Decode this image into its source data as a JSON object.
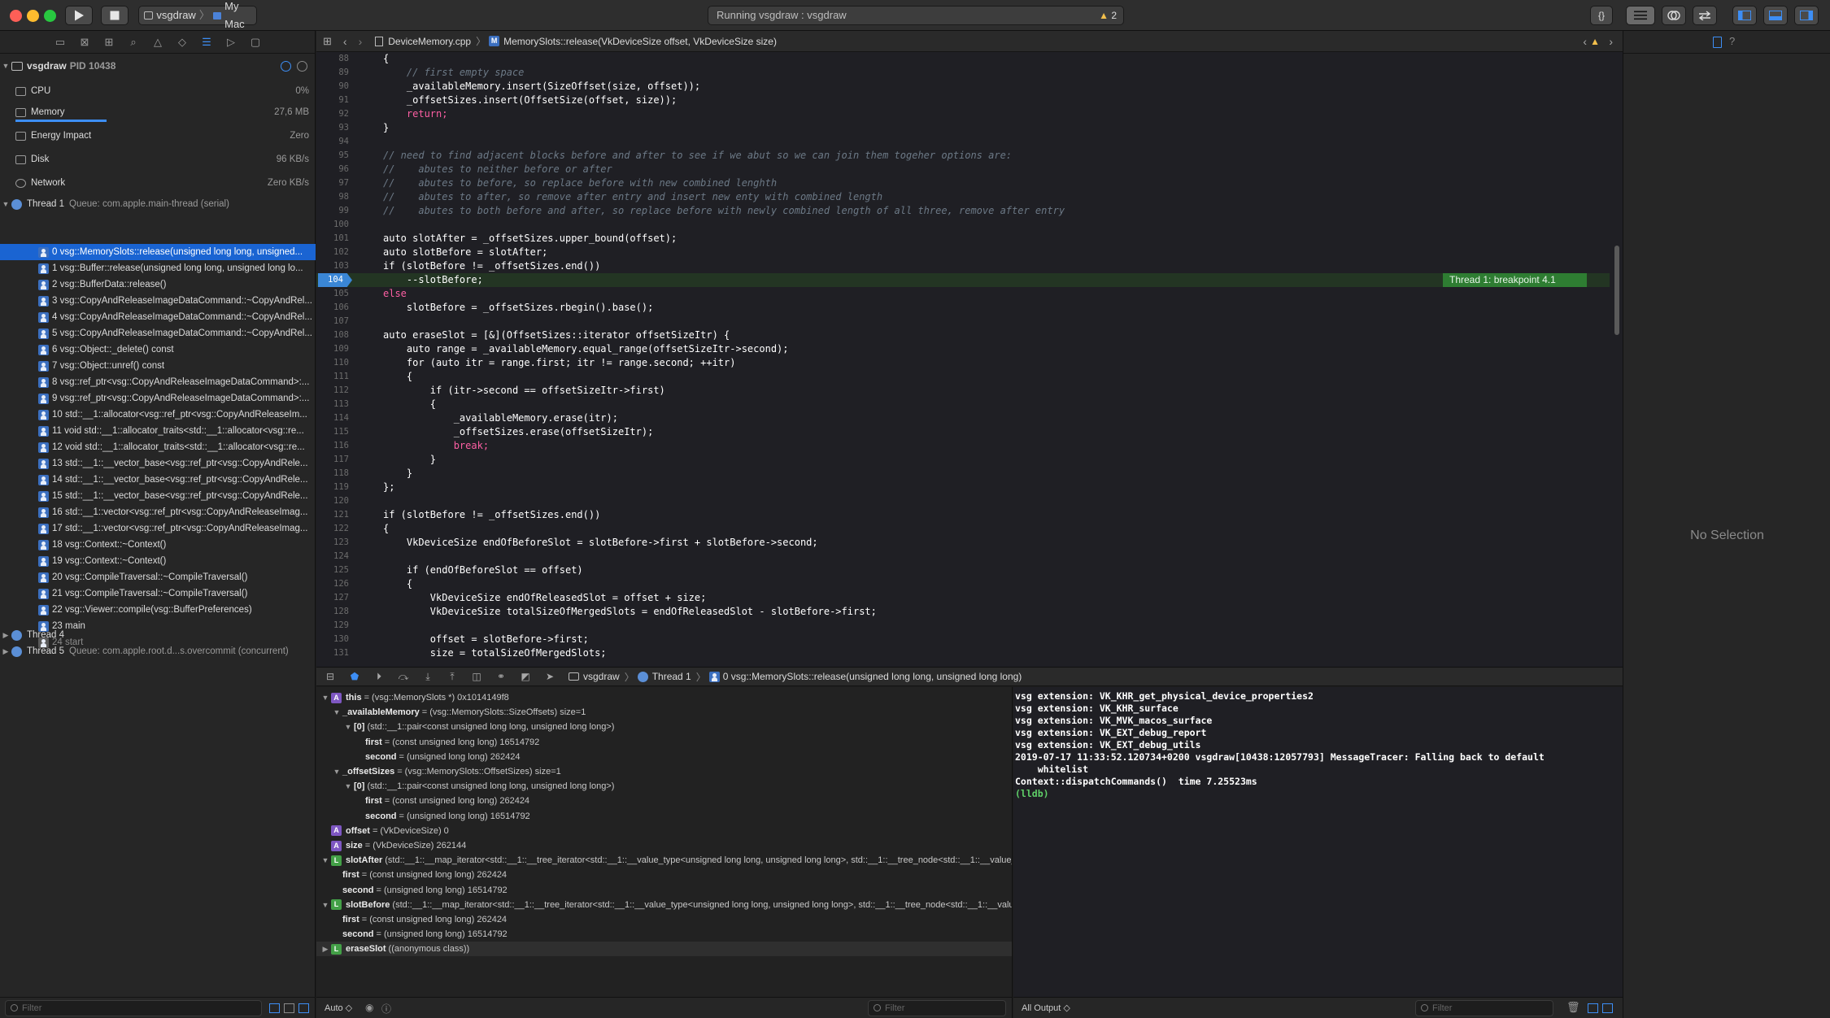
{
  "toolbar": {
    "scheme_target": "vsgdraw",
    "scheme_device": "My Mac",
    "activity_text": "Running vsgdraw : vsgdraw",
    "warning_count": "2",
    "code_review_label": "{}"
  },
  "navigator": {
    "process_name": "vsgdraw",
    "process_pid": "PID 10438",
    "gauges": [
      {
        "label": "CPU",
        "value": "0%"
      },
      {
        "label": "Memory",
        "value": "27,6 MB"
      },
      {
        "label": "Energy Impact",
        "value": "Zero"
      },
      {
        "label": "Disk",
        "value": "96 KB/s"
      },
      {
        "label": "Network",
        "value": "Zero KB/s"
      }
    ],
    "thread1_label": "Thread 1",
    "thread1_queue": "Queue: com.apple.main-thread (serial)",
    "frames": [
      "0 vsg::MemorySlots::release(unsigned long long, unsigned...",
      "1 vsg::Buffer::release(unsigned long long, unsigned long lo...",
      "2 vsg::BufferData::release()",
      "3 vsg::CopyAndReleaseImageDataCommand::~CopyAndRel...",
      "4 vsg::CopyAndReleaseImageDataCommand::~CopyAndRel...",
      "5 vsg::CopyAndReleaseImageDataCommand::~CopyAndRel...",
      "6 vsg::Object::_delete() const",
      "7 vsg::Object::unref() const",
      "8 vsg::ref_ptr<vsg::CopyAndReleaseImageDataCommand>:...",
      "9 vsg::ref_ptr<vsg::CopyAndReleaseImageDataCommand>:...",
      "10 std::__1::allocator<vsg::ref_ptr<vsg::CopyAndReleaseIm...",
      "11 void std::__1::allocator_traits<std::__1::allocator<vsg::re...",
      "12 void std::__1::allocator_traits<std::__1::allocator<vsg::re...",
      "13 std::__1::__vector_base<vsg::ref_ptr<vsg::CopyAndRele...",
      "14 std::__1::__vector_base<vsg::ref_ptr<vsg::CopyAndRele...",
      "15 std::__1::__vector_base<vsg::ref_ptr<vsg::CopyAndRele...",
      "16 std::__1::vector<vsg::ref_ptr<vsg::CopyAndReleaseImag...",
      "17 std::__1::vector<vsg::ref_ptr<vsg::CopyAndReleaseImag...",
      "18 vsg::Context::~Context()",
      "19 vsg::Context::~Context()",
      "20 vsg::CompileTraversal::~CompileTraversal()",
      "21 vsg::CompileTraversal::~CompileTraversal()",
      "22 vsg::Viewer::compile(vsg::BufferPreferences)",
      "23 main",
      "24 start"
    ],
    "thread4_label": "Thread 4",
    "thread5_label": "Thread 5",
    "thread5_queue": "Queue: com.apple.root.d...s.overcommit (concurrent)",
    "filter_placeholder": "Filter"
  },
  "jumpbar": {
    "file": "DeviceMemory.cpp",
    "method_badge": "M",
    "method": "MemorySlots::release(VkDeviceSize offset, VkDeviceSize size)"
  },
  "editor": {
    "breakpoint_line": "104",
    "breakpoint_badge": "Thread 1: breakpoint 4.1",
    "lines": [
      {
        "n": "88",
        "t": "{",
        "c": ""
      },
      {
        "n": "89",
        "t": "    // first empty space",
        "c": "cm"
      },
      {
        "n": "90",
        "t": "    _availableMemory.insert(SizeOffset(size, offset));",
        "c": ""
      },
      {
        "n": "91",
        "t": "    _offsetSizes.insert(OffsetSize(offset, size));",
        "c": ""
      },
      {
        "n": "92",
        "t": "    return;",
        "c": "kw"
      },
      {
        "n": "93",
        "t": "}",
        "c": ""
      },
      {
        "n": "94",
        "t": "",
        "c": ""
      },
      {
        "n": "95",
        "t": "// need to find adjacent blocks before and after to see if we abut so we can join them togeher options are:",
        "c": "cm"
      },
      {
        "n": "96",
        "t": "//    abutes to neither before or after",
        "c": "cm"
      },
      {
        "n": "97",
        "t": "//    abutes to before, so replace before with new combined lenghth",
        "c": "cm"
      },
      {
        "n": "98",
        "t": "//    abutes to after, so remove after entry and insert new enty with combined length",
        "c": "cm"
      },
      {
        "n": "99",
        "t": "//    abutes to both before and after, so replace before with newly combined length of all three, remove after entry",
        "c": "cm"
      },
      {
        "n": "100",
        "t": "",
        "c": ""
      },
      {
        "n": "101",
        "t": "auto slotAfter = _offsetSizes.upper_bound(offset);",
        "c": ""
      },
      {
        "n": "102",
        "t": "auto slotBefore = slotAfter;",
        "c": ""
      },
      {
        "n": "103",
        "t": "if (slotBefore != _offsetSizes.end())",
        "c": ""
      },
      {
        "n": "104",
        "t": "    --slotBefore;",
        "c": ""
      },
      {
        "n": "105",
        "t": "else",
        "c": "kw"
      },
      {
        "n": "106",
        "t": "    slotBefore = _offsetSizes.rbegin().base();",
        "c": ""
      },
      {
        "n": "107",
        "t": "",
        "c": ""
      },
      {
        "n": "108",
        "t": "auto eraseSlot = [&](OffsetSizes::iterator offsetSizeItr) {",
        "c": ""
      },
      {
        "n": "109",
        "t": "    auto range = _availableMemory.equal_range(offsetSizeItr->second);",
        "c": ""
      },
      {
        "n": "110",
        "t": "    for (auto itr = range.first; itr != range.second; ++itr)",
        "c": ""
      },
      {
        "n": "111",
        "t": "    {",
        "c": ""
      },
      {
        "n": "112",
        "t": "        if (itr->second == offsetSizeItr->first)",
        "c": ""
      },
      {
        "n": "113",
        "t": "        {",
        "c": ""
      },
      {
        "n": "114",
        "t": "            _availableMemory.erase(itr);",
        "c": ""
      },
      {
        "n": "115",
        "t": "            _offsetSizes.erase(offsetSizeItr);",
        "c": ""
      },
      {
        "n": "116",
        "t": "            break;",
        "c": "kw"
      },
      {
        "n": "117",
        "t": "        }",
        "c": ""
      },
      {
        "n": "118",
        "t": "    }",
        "c": ""
      },
      {
        "n": "119",
        "t": "};",
        "c": ""
      },
      {
        "n": "120",
        "t": "",
        "c": ""
      },
      {
        "n": "121",
        "t": "if (slotBefore != _offsetSizes.end())",
        "c": ""
      },
      {
        "n": "122",
        "t": "{",
        "c": ""
      },
      {
        "n": "123",
        "t": "    VkDeviceSize endOfBeforeSlot = slotBefore->first + slotBefore->second;",
        "c": ""
      },
      {
        "n": "124",
        "t": "",
        "c": ""
      },
      {
        "n": "125",
        "t": "    if (endOfBeforeSlot == offset)",
        "c": ""
      },
      {
        "n": "126",
        "t": "    {",
        "c": ""
      },
      {
        "n": "127",
        "t": "        VkDeviceSize endOfReleasedSlot = offset + size;",
        "c": ""
      },
      {
        "n": "128",
        "t": "        VkDeviceSize totalSizeOfMergedSlots = endOfReleasedSlot - slotBefore->first;",
        "c": ""
      },
      {
        "n": "129",
        "t": "",
        "c": ""
      },
      {
        "n": "130",
        "t": "        offset = slotBefore->first;",
        "c": ""
      },
      {
        "n": "131",
        "t": "        size = totalSizeOfMergedSlots;",
        "c": ""
      }
    ]
  },
  "debugbar": {
    "crumb_target": "vsgdraw",
    "crumb_thread": "Thread 1",
    "crumb_frame": "0 vsg::MemorySlots::release(unsigned long long, unsigned long long)"
  },
  "variables": [
    {
      "indent": 0,
      "disc": "▼",
      "badge": "A",
      "name": "this",
      "rest": "= (vsg::MemorySlots *) 0x1014149f8"
    },
    {
      "indent": 1,
      "disc": "▼",
      "badge": "",
      "name": "_availableMemory",
      "rest": "= (vsg::MemorySlots::SizeOffsets) size=1"
    },
    {
      "indent": 2,
      "disc": "▼",
      "badge": "",
      "name": "[0]",
      "rest": "(std::__1::pair<const unsigned long long, unsigned long long>)"
    },
    {
      "indent": 3,
      "disc": "",
      "badge": "",
      "name": "first",
      "rest": "= (const unsigned long long) 16514792"
    },
    {
      "indent": 3,
      "disc": "",
      "badge": "",
      "name": "second",
      "rest": "= (unsigned long long) 262424"
    },
    {
      "indent": 1,
      "disc": "▼",
      "badge": "",
      "name": "_offsetSizes",
      "rest": "= (vsg::MemorySlots::OffsetSizes) size=1"
    },
    {
      "indent": 2,
      "disc": "▼",
      "badge": "",
      "name": "[0]",
      "rest": "(std::__1::pair<const unsigned long long, unsigned long long>)"
    },
    {
      "indent": 3,
      "disc": "",
      "badge": "",
      "name": "first",
      "rest": "= (const unsigned long long) 262424"
    },
    {
      "indent": 3,
      "disc": "",
      "badge": "",
      "name": "second",
      "rest": "= (unsigned long long) 16514792"
    },
    {
      "indent": 0,
      "disc": "",
      "badge": "A",
      "name": "offset",
      "rest": "= (VkDeviceSize) 0"
    },
    {
      "indent": 0,
      "disc": "",
      "badge": "A",
      "name": "size",
      "rest": "= (VkDeviceSize) 262144"
    },
    {
      "indent": 0,
      "disc": "▼",
      "badge": "L",
      "name": "slotAfter",
      "rest": "(std::__1::__map_iterator<std::__1::__tree_iterator<std::__1::__value_type<unsigned long long, unsigned long long>, std::__1::__tree_node<std::__1::__value_type<u..."
    },
    {
      "indent": 1,
      "disc": "",
      "badge": "",
      "name": "first",
      "rest": "= (const unsigned long long) 262424"
    },
    {
      "indent": 1,
      "disc": "",
      "badge": "",
      "name": "second",
      "rest": "= (unsigned long long) 16514792"
    },
    {
      "indent": 0,
      "disc": "▼",
      "badge": "L",
      "name": "slotBefore",
      "rest": "(std::__1::__map_iterator<std::__1::__tree_iterator<std::__1::__value_type<unsigned long long, unsigned long long>, std::__1::__tree_node<std::__1::__value_type..."
    },
    {
      "indent": 1,
      "disc": "",
      "badge": "",
      "name": "first",
      "rest": "= (const unsigned long long) 262424"
    },
    {
      "indent": 1,
      "disc": "",
      "badge": "",
      "name": "second",
      "rest": "= (unsigned long long) 16514792"
    },
    {
      "indent": 0,
      "disc": "▶",
      "badge": "L",
      "name": "eraseSlot",
      "rest": "((anonymous class))"
    }
  ],
  "var_footer": {
    "scope": "Auto ◇",
    "filter_placeholder": "Filter"
  },
  "console": {
    "lines": [
      "vsg extension: VK_KHR_get_physical_device_properties2",
      "vsg extension: VK_KHR_surface",
      "vsg extension: VK_MVK_macos_surface",
      "vsg extension: VK_EXT_debug_report",
      "vsg extension: VK_EXT_debug_utils",
      "2019-07-17 11:33:52.120734+0200 vsgdraw[10438:12057793] MessageTracer: Falling back to default",
      "    whitelist",
      "Context::dispatchCommands()  time 7.25523ms"
    ],
    "prompt": "(lldb)",
    "output_selector": "All Output ◇",
    "filter_placeholder": "Filter"
  },
  "inspector": {
    "empty_text": "No Selection"
  },
  "colors": {
    "accent": "#1a64d2",
    "breakpoint": "#3a86d6",
    "breakpoint_badge": "#2e7d32",
    "keyword": "#fc5fa3",
    "comment": "#6c7986",
    "lldb_prompt": "#5fd068"
  }
}
